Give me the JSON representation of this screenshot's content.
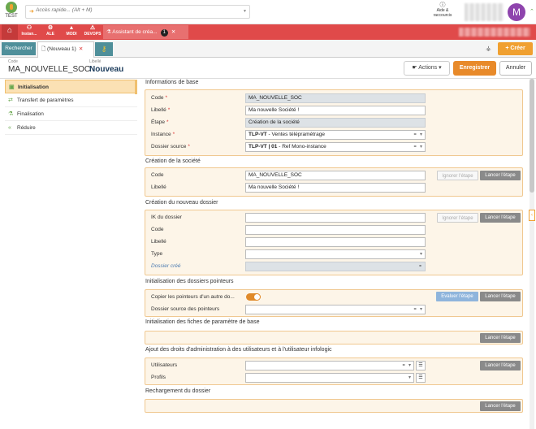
{
  "app": {
    "logo_label": "TEST",
    "quick_access_placeholder": "Accès rapide... (Alt + M)",
    "help_label": "Aide & raccourcis",
    "avatar_letter": "M"
  },
  "toolbar_tabs": [
    {
      "label": "Instan..."
    },
    {
      "label": "ALE"
    },
    {
      "label": "MODI"
    },
    {
      "label": "DEVOPS"
    }
  ],
  "page_tab": {
    "label": "Assistant de créa...",
    "badge": "1"
  },
  "subtabs": {
    "search": "Rechercher",
    "doc": "(Nouveau 1)"
  },
  "create_button": "Créer",
  "header": {
    "code_label": "Code",
    "code_value": "MA_NOUVELLE_SOC",
    "libelle_label": "Libellé",
    "libelle_value": "Nouveau",
    "actions_button": "Actions",
    "save_button": "Enregistrer",
    "cancel_button": "Annuler"
  },
  "steps": [
    {
      "label": "Initialisation",
      "icon": "init-icon",
      "active": true
    },
    {
      "label": "Transfert de paramètres",
      "icon": "transfer-icon",
      "active": false
    },
    {
      "label": "Finalisation",
      "icon": "finalize-icon",
      "active": false
    },
    {
      "label": "Réduire",
      "icon": "collapse-icon",
      "active": false
    }
  ],
  "sections": {
    "base": {
      "title": "Informations de base",
      "code_label": "Code",
      "code_value": "MA_NOUVELLE_SOC",
      "libelle_label": "Libellé",
      "libelle_value": "Ma nouvelle Société !",
      "etape_label": "Étape",
      "etape_value": "Création de la société",
      "instance_label": "Instance",
      "instance_code": "TLP-VT",
      "instance_text": " - Ventes télépramétrage",
      "dossier_label": "Dossier source",
      "dossier_code": "TLP-VT | 01",
      "dossier_text": " - Ref Mono-instance"
    },
    "societe": {
      "title": "Création de la société",
      "code_label": "Code",
      "code_value": "MA_NOUVELLE_SOC",
      "libelle_label": "Libellé",
      "libelle_value": "Ma nouvelle Société !",
      "ignore_button": "Ignorer l'étape",
      "launch_button": "Lancer l'étape"
    },
    "dossier": {
      "title": "Création du nouveau dossier",
      "ik_label": "IK du dossier",
      "code_label": "Code",
      "libelle_label": "Libellé",
      "type_label": "Type",
      "cree_label": "Dossier créé",
      "ignore_button": "Ignorer l'étape",
      "launch_button": "Lancer l'étape"
    },
    "pointeurs": {
      "title": "Initialisation des dossiers pointeurs",
      "copy_label": "Copier les pointeurs d'un autre do...",
      "source_label": "Dossier source des pointeurs",
      "eval_button": "Evaluer l'étape",
      "launch_button": "Lancer l'étape"
    },
    "fiches": {
      "title": "Initialisation des fiches de paramètre de base",
      "launch_button": "Lancer l'étape"
    },
    "droits": {
      "title": "Ajout des droits d'administration à des utilisateurs et à l'utilisateur infologic",
      "users_label": "Utilisateurs",
      "profils_label": "Profils",
      "launch_button": "Lancer l'étape"
    },
    "recharge": {
      "title": "Rechargement du dossier",
      "launch_button": "Lancer l'étape"
    }
  },
  "colors": {
    "accent": "#f0a030",
    "tabbar": "#e04a4a",
    "teal": "#4f8f9a",
    "avatar": "#8e44ad"
  }
}
